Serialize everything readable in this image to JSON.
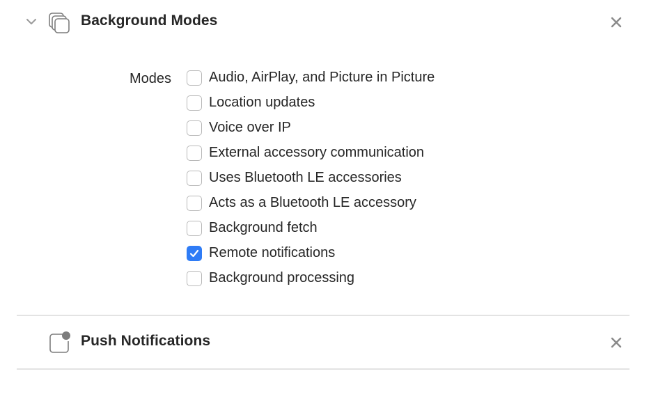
{
  "background_modes": {
    "title": "Background Modes",
    "modes_label": "Modes",
    "modes": [
      {
        "label": "Audio, AirPlay, and Picture in Picture",
        "checked": false
      },
      {
        "label": "Location updates",
        "checked": false
      },
      {
        "label": "Voice over IP",
        "checked": false
      },
      {
        "label": "External accessory communication",
        "checked": false
      },
      {
        "label": "Uses Bluetooth LE accessories",
        "checked": false
      },
      {
        "label": "Acts as a Bluetooth LE accessory",
        "checked": false
      },
      {
        "label": "Background fetch",
        "checked": false
      },
      {
        "label": "Remote notifications",
        "checked": true
      },
      {
        "label": "Background processing",
        "checked": false
      }
    ],
    "icon": "background-modes-icon"
  },
  "push_notifications": {
    "title": "Push Notifications",
    "icon": "push-notifications-icon"
  },
  "icons": {
    "collapse": "chevron-down-icon",
    "remove": "close-icon",
    "check": "checkmark-icon"
  },
  "colors": {
    "accent": "#2f7cf6",
    "text": "#262626",
    "icon_gray": "#8a8a8a",
    "divider": "#e3e3e3",
    "checkbox_border": "#b9b9b9"
  }
}
